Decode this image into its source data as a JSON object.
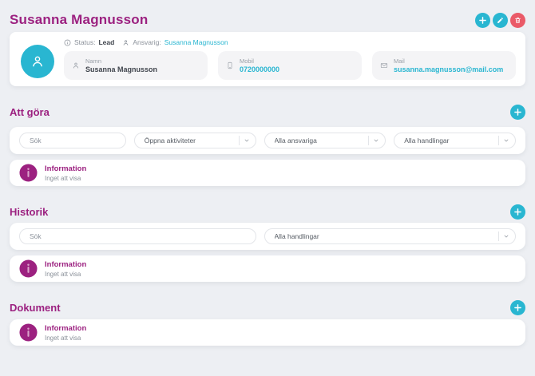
{
  "page": {
    "title": "Susanna Magnusson"
  },
  "header": {
    "actions": {
      "add": "plus",
      "edit": "pencil",
      "delete": "trash"
    }
  },
  "contact": {
    "status_label": "Status:",
    "status_value": "Lead",
    "owner_label": "Ansvarig:",
    "owner_value": "Susanna Magnusson",
    "fields": [
      {
        "label": "Namn",
        "value": "Susanna Magnusson",
        "icon": "person-icon"
      },
      {
        "label": "Mobil",
        "value": "0720000000",
        "icon": "phone-icon"
      },
      {
        "label": "Mail",
        "value": "susanna.magnusson@mail.com",
        "icon": "mail-icon"
      }
    ]
  },
  "sections": {
    "todo": {
      "title": "Att göra",
      "search_placeholder": "Sök",
      "filters": [
        "Öppna aktiviteter",
        "Alla ansvariga",
        "Alla handlingar"
      ],
      "empty": {
        "title": "Information",
        "message": "Inget att visa"
      }
    },
    "history": {
      "title": "Historik",
      "search_placeholder": "Sök",
      "filters": [
        "Alla handlingar"
      ],
      "empty": {
        "title": "Information",
        "message": "Inget att visa"
      }
    },
    "documents": {
      "title": "Dokument",
      "empty": {
        "title": "Information",
        "message": "Inget att visa"
      }
    }
  },
  "colors": {
    "accent_magenta": "#9c2180",
    "accent_teal": "#29b6d1",
    "danger_red": "#ea5a68",
    "page_background": "#edeff3"
  }
}
